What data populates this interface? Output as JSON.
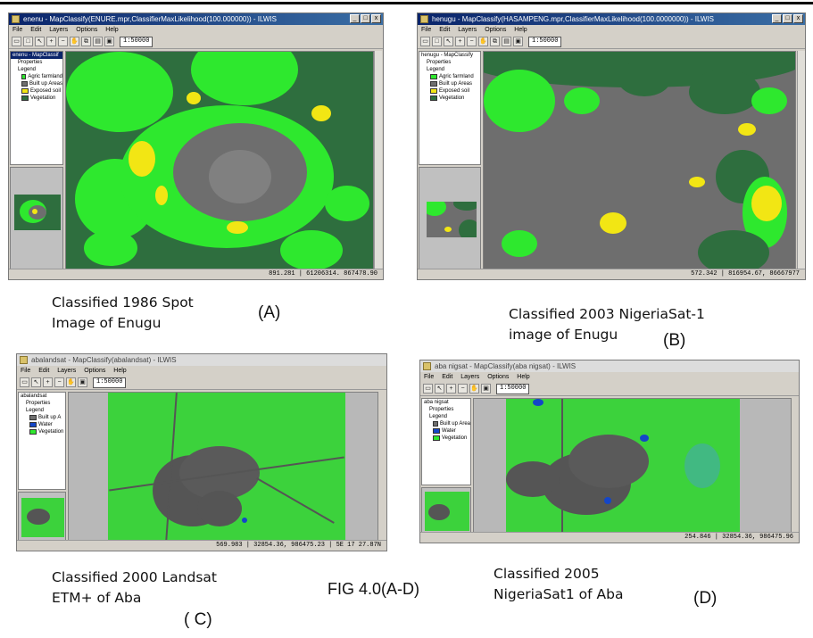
{
  "windows": {
    "a": {
      "title": "enenu - MapClassify(ENURE.mpr,ClassifierMaxLikelihood(100.000000)) - ILWIS",
      "menu": [
        "File",
        "Edit",
        "Layers",
        "Options",
        "Help"
      ],
      "scale": "1:50000",
      "tree": {
        "root": "enenu - MapClassif",
        "properties": "Properties",
        "legend": "Legend",
        "classes": [
          "Agric farmland",
          "Built up Areas",
          "Exposed soil",
          "Vegetation"
        ]
      },
      "status": "891.281    |  61206314.  867478.90"
    },
    "b": {
      "title": "henugu - MapClassify(HASAMPENG.mpr,ClassifierMaxLikelihood(100.0000000)) - ILWIS",
      "menu": [
        "File",
        "Edit",
        "Layers",
        "Options",
        "Help"
      ],
      "scale": "1:50000",
      "tree": {
        "root": "henugu - MapClassify",
        "properties": "Properties",
        "legend": "Legend",
        "classes": [
          "Agric farmland",
          "Built up Areas",
          "Exposed soil",
          "Vegetation"
        ]
      },
      "status": "572.342    |  816954.67,  86667977"
    },
    "c": {
      "title": "abalandsat - MapClassify(abalandsat) - ILWIS",
      "menu": [
        "File",
        "Edit",
        "Layers",
        "Options",
        "Help"
      ],
      "scale": "1:50000",
      "tree": {
        "root": "abalandsat",
        "properties": "Properties",
        "legend": "Legend",
        "classes": [
          "Built up A",
          "Water",
          "Vegetation"
        ]
      },
      "status": "569.983  |  32854.36, 986475.23  |  5E 17 27.87N"
    },
    "d": {
      "title": "aba nigsat - MapClassify(aba nigsat) - ILWIS",
      "menu": [
        "File",
        "Edit",
        "Layers",
        "Options",
        "Help"
      ],
      "scale": "1:50000",
      "tree": {
        "root": "aba nigsat",
        "properties": "Properties",
        "legend": "Legend",
        "classes": [
          "Built up Area",
          "Water",
          "Vegetation"
        ]
      },
      "status": "254.846  |  32854.36, 986475.96"
    }
  },
  "captions": {
    "a": [
      "Classified 1986 Spot",
      "Image of Enugu"
    ],
    "a_letter": "(A)",
    "b": [
      "Classified 2003 NigeriaSat-1",
      "image of Enugu"
    ],
    "b_letter": "(B)",
    "c": [
      "Classified 2000 Landsat",
      "ETM+ of Aba"
    ],
    "c_letter": "( C)",
    "d": [
      "Classified 2005",
      "NigeriaSat1 of Aba"
    ],
    "d_letter": "(D)",
    "figure_title": "FIG 4.0(A-D)"
  },
  "colors": {
    "agric": "#2ee82e",
    "built": "#6e6e6e",
    "exposed": "#f2e614",
    "vegetation": "#2e6e3e",
    "water": "#1446c8",
    "bright_green": "#3cd23c"
  }
}
